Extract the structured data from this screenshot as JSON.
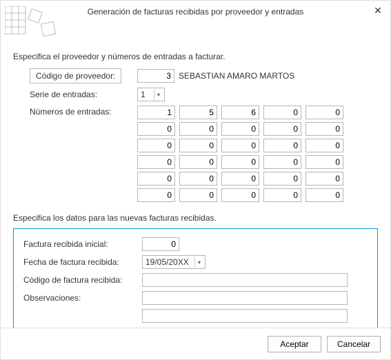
{
  "title": "Generación de facturas recibidas por proveedor y entradas",
  "close_glyph": "✕",
  "section1": {
    "intro": "Especifica el proveedor y números de entradas a facturar.",
    "provider_code_label": "Código de proveedor:",
    "provider_code_value": "3",
    "provider_name": "SEBASTIAN AMARO MARTOS",
    "entry_series_label": "Serie de entradas:",
    "entry_series_value": "1",
    "entry_numbers_label": "Números de entradas:",
    "grid": [
      [
        "1",
        "5",
        "6",
        "0",
        "0"
      ],
      [
        "0",
        "0",
        "0",
        "0",
        "0"
      ],
      [
        "0",
        "0",
        "0",
        "0",
        "0"
      ],
      [
        "0",
        "0",
        "0",
        "0",
        "0"
      ],
      [
        "0",
        "0",
        "0",
        "0",
        "0"
      ],
      [
        "0",
        "0",
        "0",
        "0",
        "0"
      ]
    ]
  },
  "section2": {
    "intro": "Especifica los datos para las nuevas facturas recibidas.",
    "initial_invoice_label": "Factura recibida inicial:",
    "initial_invoice_value": "0",
    "invoice_date_label": "Fecha de factura recibida:",
    "invoice_date_value": "19/05/20XX",
    "invoice_code_label": "Código de factura recibida:",
    "invoice_code_value": "",
    "notes_label": "Observaciones:",
    "notes_value1": "",
    "notes_value2": ""
  },
  "footer": {
    "accept": "Aceptar",
    "cancel": "Cancelar"
  },
  "caret_glyph": "▾"
}
